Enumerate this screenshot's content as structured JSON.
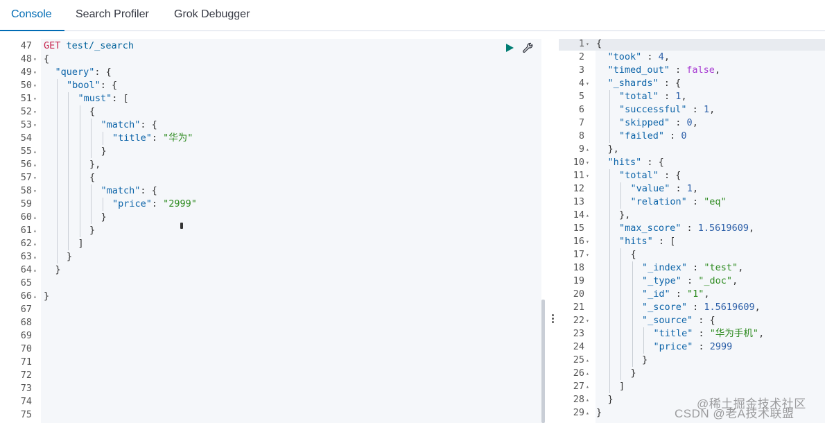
{
  "tabs": [
    {
      "label": "Console",
      "active": true
    },
    {
      "label": "Search Profiler",
      "active": false
    },
    {
      "label": "Grok Debugger",
      "active": false
    }
  ],
  "request": {
    "lines": [
      {
        "n": "47",
        "fold": "",
        "indent": 0,
        "tokens": [
          [
            "method",
            "GET"
          ],
          [
            "punc",
            " "
          ],
          [
            "url",
            "test/_search"
          ]
        ]
      },
      {
        "n": "48",
        "fold": "down",
        "indent": 0,
        "tokens": [
          [
            "punc",
            "{"
          ]
        ]
      },
      {
        "n": "49",
        "fold": "down",
        "indent": 1,
        "tokens": [
          [
            "key",
            "\"query\""
          ],
          [
            "punc",
            ": {"
          ]
        ]
      },
      {
        "n": "50",
        "fold": "down",
        "indent": 2,
        "tokens": [
          [
            "key",
            "\"bool\""
          ],
          [
            "punc",
            ": {"
          ]
        ]
      },
      {
        "n": "51",
        "fold": "down",
        "indent": 3,
        "tokens": [
          [
            "key",
            "\"must\""
          ],
          [
            "punc",
            ": ["
          ]
        ]
      },
      {
        "n": "52",
        "fold": "down",
        "indent": 4,
        "tokens": [
          [
            "punc",
            "{"
          ]
        ]
      },
      {
        "n": "53",
        "fold": "down",
        "indent": 5,
        "tokens": [
          [
            "key",
            "\"match\""
          ],
          [
            "punc",
            ": {"
          ]
        ]
      },
      {
        "n": "54",
        "fold": "",
        "indent": 6,
        "tokens": [
          [
            "key",
            "\"title\""
          ],
          [
            "punc",
            ": "
          ],
          [
            "str",
            "\"华为\""
          ]
        ]
      },
      {
        "n": "55",
        "fold": "up",
        "indent": 5,
        "tokens": [
          [
            "punc",
            "}"
          ]
        ]
      },
      {
        "n": "56",
        "fold": "up",
        "indent": 4,
        "tokens": [
          [
            "punc",
            "},"
          ]
        ]
      },
      {
        "n": "57",
        "fold": "down",
        "indent": 4,
        "tokens": [
          [
            "punc",
            "{"
          ]
        ]
      },
      {
        "n": "58",
        "fold": "down",
        "indent": 5,
        "tokens": [
          [
            "key",
            "\"match\""
          ],
          [
            "punc",
            ": {"
          ]
        ]
      },
      {
        "n": "59",
        "fold": "",
        "indent": 6,
        "tokens": [
          [
            "key",
            "\"price\""
          ],
          [
            "punc",
            ": "
          ],
          [
            "str",
            "\"2999\""
          ]
        ]
      },
      {
        "n": "60",
        "fold": "up",
        "indent": 5,
        "tokens": [
          [
            "punc",
            "}"
          ]
        ]
      },
      {
        "n": "61",
        "fold": "up",
        "indent": 4,
        "tokens": [
          [
            "punc",
            "}"
          ]
        ]
      },
      {
        "n": "62",
        "fold": "up",
        "indent": 3,
        "tokens": [
          [
            "punc",
            "]"
          ]
        ]
      },
      {
        "n": "63",
        "fold": "up",
        "indent": 2,
        "tokens": [
          [
            "punc",
            "}"
          ]
        ]
      },
      {
        "n": "64",
        "fold": "up",
        "indent": 1,
        "tokens": [
          [
            "punc",
            "}"
          ]
        ]
      },
      {
        "n": "65",
        "fold": "",
        "indent": 0,
        "tokens": []
      },
      {
        "n": "66",
        "fold": "up",
        "indent": 0,
        "tokens": [
          [
            "punc",
            "}"
          ]
        ]
      },
      {
        "n": "67",
        "fold": "",
        "indent": 0,
        "tokens": []
      },
      {
        "n": "68",
        "fold": "",
        "indent": 0,
        "tokens": []
      },
      {
        "n": "69",
        "fold": "",
        "indent": 0,
        "tokens": []
      },
      {
        "n": "70",
        "fold": "",
        "indent": 0,
        "tokens": []
      },
      {
        "n": "71",
        "fold": "",
        "indent": 0,
        "tokens": []
      },
      {
        "n": "72",
        "fold": "",
        "indent": 0,
        "tokens": []
      },
      {
        "n": "73",
        "fold": "",
        "indent": 0,
        "tokens": []
      },
      {
        "n": "74",
        "fold": "",
        "indent": 0,
        "tokens": []
      },
      {
        "n": "75",
        "fold": "",
        "indent": 0,
        "tokens": []
      }
    ]
  },
  "response": {
    "lines": [
      {
        "n": "1",
        "fold": "down",
        "indent": 0,
        "tokens": [
          [
            "punc",
            "{"
          ]
        ]
      },
      {
        "n": "2",
        "fold": "",
        "indent": 1,
        "tokens": [
          [
            "key",
            "\"took\""
          ],
          [
            "punc",
            " : "
          ],
          [
            "num",
            "4"
          ],
          [
            "punc",
            ","
          ]
        ]
      },
      {
        "n": "3",
        "fold": "",
        "indent": 1,
        "tokens": [
          [
            "key",
            "\"timed_out\""
          ],
          [
            "punc",
            " : "
          ],
          [
            "bool",
            "false"
          ],
          [
            "punc",
            ","
          ]
        ]
      },
      {
        "n": "4",
        "fold": "down",
        "indent": 1,
        "tokens": [
          [
            "key",
            "\"_shards\""
          ],
          [
            "punc",
            " : {"
          ]
        ]
      },
      {
        "n": "5",
        "fold": "",
        "indent": 2,
        "tokens": [
          [
            "key",
            "\"total\""
          ],
          [
            "punc",
            " : "
          ],
          [
            "num",
            "1"
          ],
          [
            "punc",
            ","
          ]
        ]
      },
      {
        "n": "6",
        "fold": "",
        "indent": 2,
        "tokens": [
          [
            "key",
            "\"successful\""
          ],
          [
            "punc",
            " : "
          ],
          [
            "num",
            "1"
          ],
          [
            "punc",
            ","
          ]
        ]
      },
      {
        "n": "7",
        "fold": "",
        "indent": 2,
        "tokens": [
          [
            "key",
            "\"skipped\""
          ],
          [
            "punc",
            " : "
          ],
          [
            "num",
            "0"
          ],
          [
            "punc",
            ","
          ]
        ]
      },
      {
        "n": "8",
        "fold": "",
        "indent": 2,
        "tokens": [
          [
            "key",
            "\"failed\""
          ],
          [
            "punc",
            " : "
          ],
          [
            "num",
            "0"
          ]
        ]
      },
      {
        "n": "9",
        "fold": "up",
        "indent": 1,
        "tokens": [
          [
            "punc",
            "},"
          ]
        ]
      },
      {
        "n": "10",
        "fold": "down",
        "indent": 1,
        "tokens": [
          [
            "key",
            "\"hits\""
          ],
          [
            "punc",
            " : {"
          ]
        ]
      },
      {
        "n": "11",
        "fold": "down",
        "indent": 2,
        "tokens": [
          [
            "key",
            "\"total\""
          ],
          [
            "punc",
            " : {"
          ]
        ]
      },
      {
        "n": "12",
        "fold": "",
        "indent": 3,
        "tokens": [
          [
            "key",
            "\"value\""
          ],
          [
            "punc",
            " : "
          ],
          [
            "num",
            "1"
          ],
          [
            "punc",
            ","
          ]
        ]
      },
      {
        "n": "13",
        "fold": "",
        "indent": 3,
        "tokens": [
          [
            "key",
            "\"relation\""
          ],
          [
            "punc",
            " : "
          ],
          [
            "str",
            "\"eq\""
          ]
        ]
      },
      {
        "n": "14",
        "fold": "up",
        "indent": 2,
        "tokens": [
          [
            "punc",
            "},"
          ]
        ]
      },
      {
        "n": "15",
        "fold": "",
        "indent": 2,
        "tokens": [
          [
            "key",
            "\"max_score\""
          ],
          [
            "punc",
            " : "
          ],
          [
            "num",
            "1.5619609"
          ],
          [
            "punc",
            ","
          ]
        ]
      },
      {
        "n": "16",
        "fold": "down",
        "indent": 2,
        "tokens": [
          [
            "key",
            "\"hits\""
          ],
          [
            "punc",
            " : ["
          ]
        ]
      },
      {
        "n": "17",
        "fold": "down",
        "indent": 3,
        "tokens": [
          [
            "punc",
            "{"
          ]
        ]
      },
      {
        "n": "18",
        "fold": "",
        "indent": 4,
        "tokens": [
          [
            "key",
            "\"_index\""
          ],
          [
            "punc",
            " : "
          ],
          [
            "str",
            "\"test\""
          ],
          [
            "punc",
            ","
          ]
        ]
      },
      {
        "n": "19",
        "fold": "",
        "indent": 4,
        "tokens": [
          [
            "key",
            "\"_type\""
          ],
          [
            "punc",
            " : "
          ],
          [
            "str",
            "\"_doc\""
          ],
          [
            "punc",
            ","
          ]
        ]
      },
      {
        "n": "20",
        "fold": "",
        "indent": 4,
        "tokens": [
          [
            "key",
            "\"_id\""
          ],
          [
            "punc",
            " : "
          ],
          [
            "str",
            "\"1\""
          ],
          [
            "punc",
            ","
          ]
        ]
      },
      {
        "n": "21",
        "fold": "",
        "indent": 4,
        "tokens": [
          [
            "key",
            "\"_score\""
          ],
          [
            "punc",
            " : "
          ],
          [
            "num",
            "1.5619609"
          ],
          [
            "punc",
            ","
          ]
        ]
      },
      {
        "n": "22",
        "fold": "down",
        "indent": 4,
        "tokens": [
          [
            "key",
            "\"_source\""
          ],
          [
            "punc",
            " : {"
          ]
        ]
      },
      {
        "n": "23",
        "fold": "",
        "indent": 5,
        "tokens": [
          [
            "key",
            "\"title\""
          ],
          [
            "punc",
            " : "
          ],
          [
            "str",
            "\"华为手机\""
          ],
          [
            "punc",
            ","
          ]
        ]
      },
      {
        "n": "24",
        "fold": "",
        "indent": 5,
        "tokens": [
          [
            "key",
            "\"price\""
          ],
          [
            "punc",
            " : "
          ],
          [
            "num",
            "2999"
          ]
        ]
      },
      {
        "n": "25",
        "fold": "up",
        "indent": 4,
        "tokens": [
          [
            "punc",
            "}"
          ]
        ]
      },
      {
        "n": "26",
        "fold": "up",
        "indent": 3,
        "tokens": [
          [
            "punc",
            "}"
          ]
        ]
      },
      {
        "n": "27",
        "fold": "up",
        "indent": 2,
        "tokens": [
          [
            "punc",
            "]"
          ]
        ]
      },
      {
        "n": "28",
        "fold": "up",
        "indent": 1,
        "tokens": [
          [
            "punc",
            "}"
          ]
        ]
      },
      {
        "n": "29",
        "fold": "up",
        "indent": 0,
        "tokens": [
          [
            "punc",
            "}"
          ]
        ]
      }
    ]
  },
  "icons": {
    "run": "play-icon",
    "settings": "wrench-icon"
  },
  "colors": {
    "accent": "#006bb4",
    "run": "#017d73"
  },
  "watermark": {
    "line1": "@稀土掘金技术社区",
    "line2": "CSDN @老A技术联盟"
  }
}
